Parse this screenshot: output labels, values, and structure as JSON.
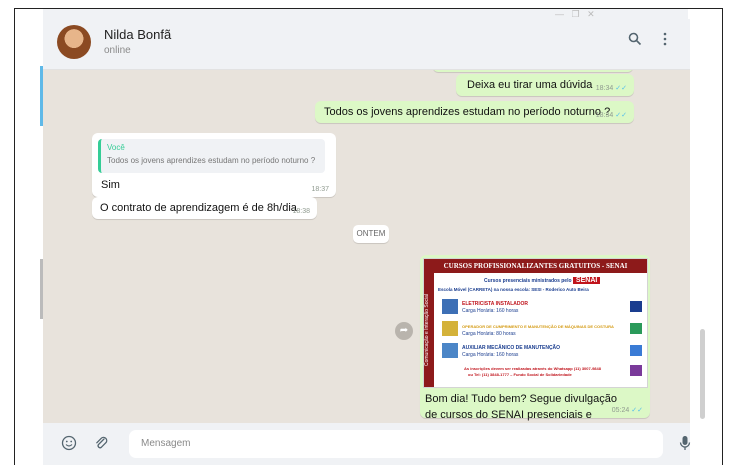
{
  "header": {
    "contact_name": "Nilda Bonfã",
    "status": "online",
    "search_icon": "search-icon",
    "menu_icon": "menu-icon"
  },
  "messages": [
    {
      "type": "out",
      "text": "Deixa eu tirar uma dúvida",
      "time": "18:34"
    },
    {
      "type": "out",
      "text": "Todos os jovens aprendizes estudam no período noturno ?",
      "time": "18:34"
    },
    {
      "type": "in",
      "quote_author": "Você",
      "quote_text": "Todos os jovens aprendizes estudam no período noturno ?",
      "text": "Sim",
      "time": "18:37"
    },
    {
      "type": "in",
      "text": "O contrato de aprendizagem é de 8h/dia",
      "time": "18:38"
    },
    {
      "type": "out_image",
      "caption": "Bom dia! Tudo bem? Segue divulgação de cursos do SENAI presenciais e gratuitos.",
      "time": "05:24"
    }
  ],
  "date_divider": "ONTEM",
  "poster": {
    "title": "CURSOS PROFISSIONALIZANTES GRATUITOS - SENAI",
    "side_text": "Comunicação e Interação Social",
    "subtitle": "Cursos presenciais ministrados pelo",
    "senai": "SENAI",
    "location": "Escola Móvel (CARRETA) na nossa escola: SESI - Roderico Auto Beira",
    "course1": "ELETRICISTA INSTALADOR",
    "course1_hours": "Carga Horária: 160 horas",
    "course2": "OPERADOR DE CUMPRIMENTO E MANUTENÇÃO DE MÁQUINAS DE COSTURA",
    "course2_hours": "Carga Horária: 80 horas",
    "course3": "AUXILIAR MECÂNICO DE MANUTENÇÃO",
    "course3_hours": "Carga Horária: 160 horas",
    "footer1": "As inscrições devem ser realizadas através do Whatsapp (11) 3007-9848",
    "footer2": "ou Tel: (11) 3848-1777 – Fundo Social de Solidariedade"
  },
  "footer": {
    "placeholder": "Mensagem",
    "emoji_icon": "emoji-icon",
    "attach_icon": "paperclip-icon",
    "mic_icon": "microphone-icon"
  },
  "colors": {
    "outgoing": "#dcf8c6",
    "incoming": "#ffffff",
    "read_tick": "#53bdeb",
    "poster_red": "#8d1a1a"
  }
}
